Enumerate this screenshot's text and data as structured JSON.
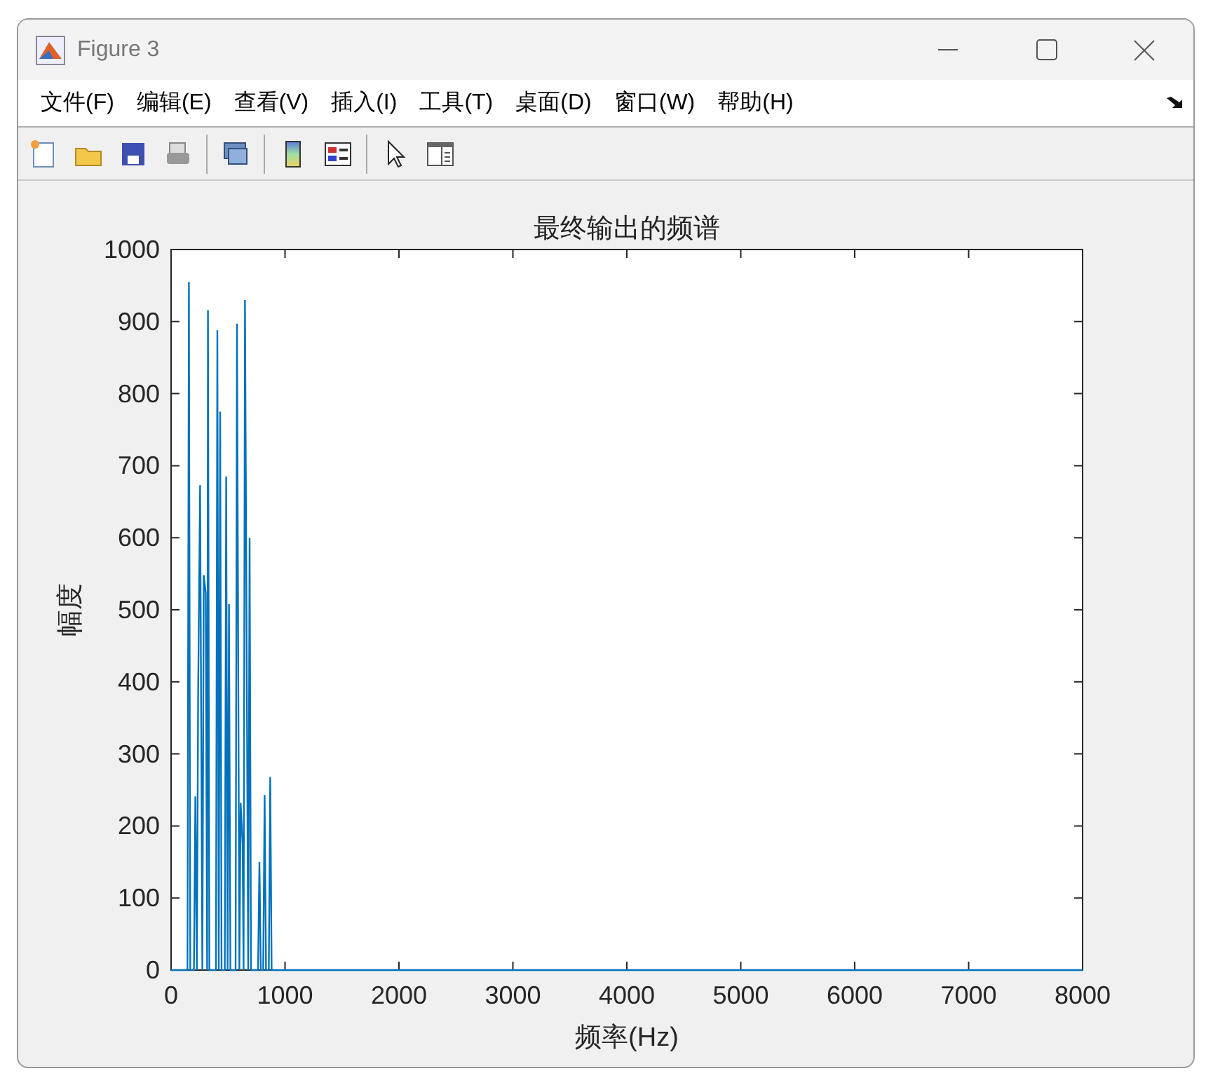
{
  "window": {
    "title": "Figure 3"
  },
  "menu": [
    "文件(F)",
    "编辑(E)",
    "查看(V)",
    "插入(I)",
    "工具(T)",
    "桌面(D)",
    "窗口(W)",
    "帮助(H)"
  ],
  "figure": {
    "chart_data": {
      "type": "line",
      "title": "最终输出的频谱",
      "xlabel": "频率(Hz)",
      "ylabel": "幅度",
      "x": [
        0,
        144,
        156,
        168,
        201,
        213,
        226,
        238,
        255,
        275,
        287,
        304,
        316,
        324,
        336,
        394,
        406,
        419,
        431,
        443,
        472,
        484,
        496,
        508,
        520,
        566,
        578,
        599,
        611,
        628,
        636,
        648,
        677,
        689,
        701,
        763,
        775,
        788,
        809,
        821,
        833,
        858,
        870,
        882,
        8000
      ],
      "series": [
        {
          "color": "#0072bd",
          "values": [
            0,
            0,
            955,
            0,
            0,
            241,
            0,
            385,
            673,
            0,
            548,
            523,
            0,
            916,
            0,
            0,
            888,
            0,
            775,
            0,
            0,
            685,
            0,
            508,
            0,
            0,
            897,
            0,
            232,
            175,
            0,
            930,
            0,
            600,
            0,
            0,
            150,
            0,
            0,
            243,
            0,
            0,
            268,
            0,
            0
          ]
        }
      ],
      "xlim": [
        0,
        8000
      ],
      "ylim": [
        0,
        1000
      ],
      "xticks": [
        0,
        1000,
        2000,
        3000,
        4000,
        5000,
        6000,
        7000,
        8000
      ],
      "yticks": [
        0,
        100,
        200,
        300,
        400,
        500,
        600,
        700,
        800,
        900,
        1000
      ]
    }
  }
}
